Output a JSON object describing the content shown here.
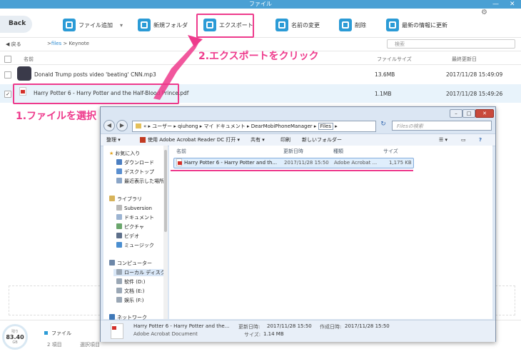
{
  "app": {
    "title": "ファイル",
    "back_label": "Back",
    "toolbar": [
      {
        "label": "ファイル追加",
        "icon": "add-file-icon"
      },
      {
        "label": "新規フォルダ",
        "icon": "new-folder-icon"
      },
      {
        "label": "エクスポート",
        "icon": "export-icon"
      },
      {
        "label": "名前の変更",
        "icon": "rename-icon"
      },
      {
        "label": "削除",
        "icon": "trash-icon"
      },
      {
        "label": "最新の情報に更新",
        "icon": "refresh-icon"
      }
    ],
    "nav": {
      "back": "戻る",
      "path_root": "files",
      "path_current": "Keynote",
      "search_placeholder": "検索"
    },
    "columns": {
      "name": "名前",
      "size": "ファイルサイズ",
      "date": "最終更新日"
    },
    "files": [
      {
        "name": "Donald Trump posts video 'beating' CNN.mp3",
        "size": "13.6MB",
        "date": "2017/11/28 15:49:09",
        "selected": false
      },
      {
        "name": "Harry Potter 6 - Harry Potter and the Half-Blood Prince.pdf",
        "size": "1.1MB",
        "date": "2017/11/28 15:49:26",
        "selected": true
      }
    ],
    "storage": {
      "label": "残り",
      "value": "83.40",
      "unit": "GB"
    },
    "footer": {
      "category": "ファイル",
      "item_count": "2 項目",
      "selected_info": "選択項目"
    }
  },
  "annotations": {
    "step1": "1.ファイルを選択",
    "step2": "2.エクスポートをクリック"
  },
  "explorer": {
    "address": [
      "«",
      "ユーザー",
      "qiuhong",
      "マイ ドキュメント",
      "DearMobiPhoneManager",
      "Files"
    ],
    "search_placeholder": "Filesの検索",
    "commands": [
      "整理 ▾",
      "使用 Adobe Acrobat Reader DC 打开 ▾",
      "共有 ▾",
      "印刷",
      "新しいフォルダー"
    ],
    "tree": {
      "favorites": [
        "お気に入り",
        "ダウンロード",
        "デスクトップ",
        "最近表示した場所"
      ],
      "libraries": [
        "ライブラリ",
        "Subversion",
        "ドキュメント",
        "ピクチャ",
        "ビデオ",
        "ミュージック"
      ],
      "computer": [
        "コンピューター",
        "ローカル ディスク",
        "软件 (D:)",
        "文档 (E:)",
        "娱乐 (F:)"
      ],
      "network": "ネットワーク"
    },
    "columns": {
      "name": "名前",
      "date": "更新日時",
      "type": "種類",
      "size": "サイズ"
    },
    "file": {
      "name": "Harry Potter 6 - Harry Potter and th...",
      "date": "2017/11/28 15:50",
      "type": "Adobe Acrobat ...",
      "size": "1,175 KB"
    },
    "details": {
      "name": "Harry Potter 6 - Harry Potter and the...",
      "type": "Adobe Acrobat Document",
      "modified_label": "更新日時:",
      "modified": "2017/11/28 15:50",
      "created_label": "作成日時:",
      "created": "2017/11/28 15:50",
      "size_label": "サイズ:",
      "size": "1.14 MB"
    }
  },
  "colors": {
    "accent": "#2b9bd6",
    "annotation": "#ee3a8c",
    "titlebar": "#4aa0d4"
  }
}
